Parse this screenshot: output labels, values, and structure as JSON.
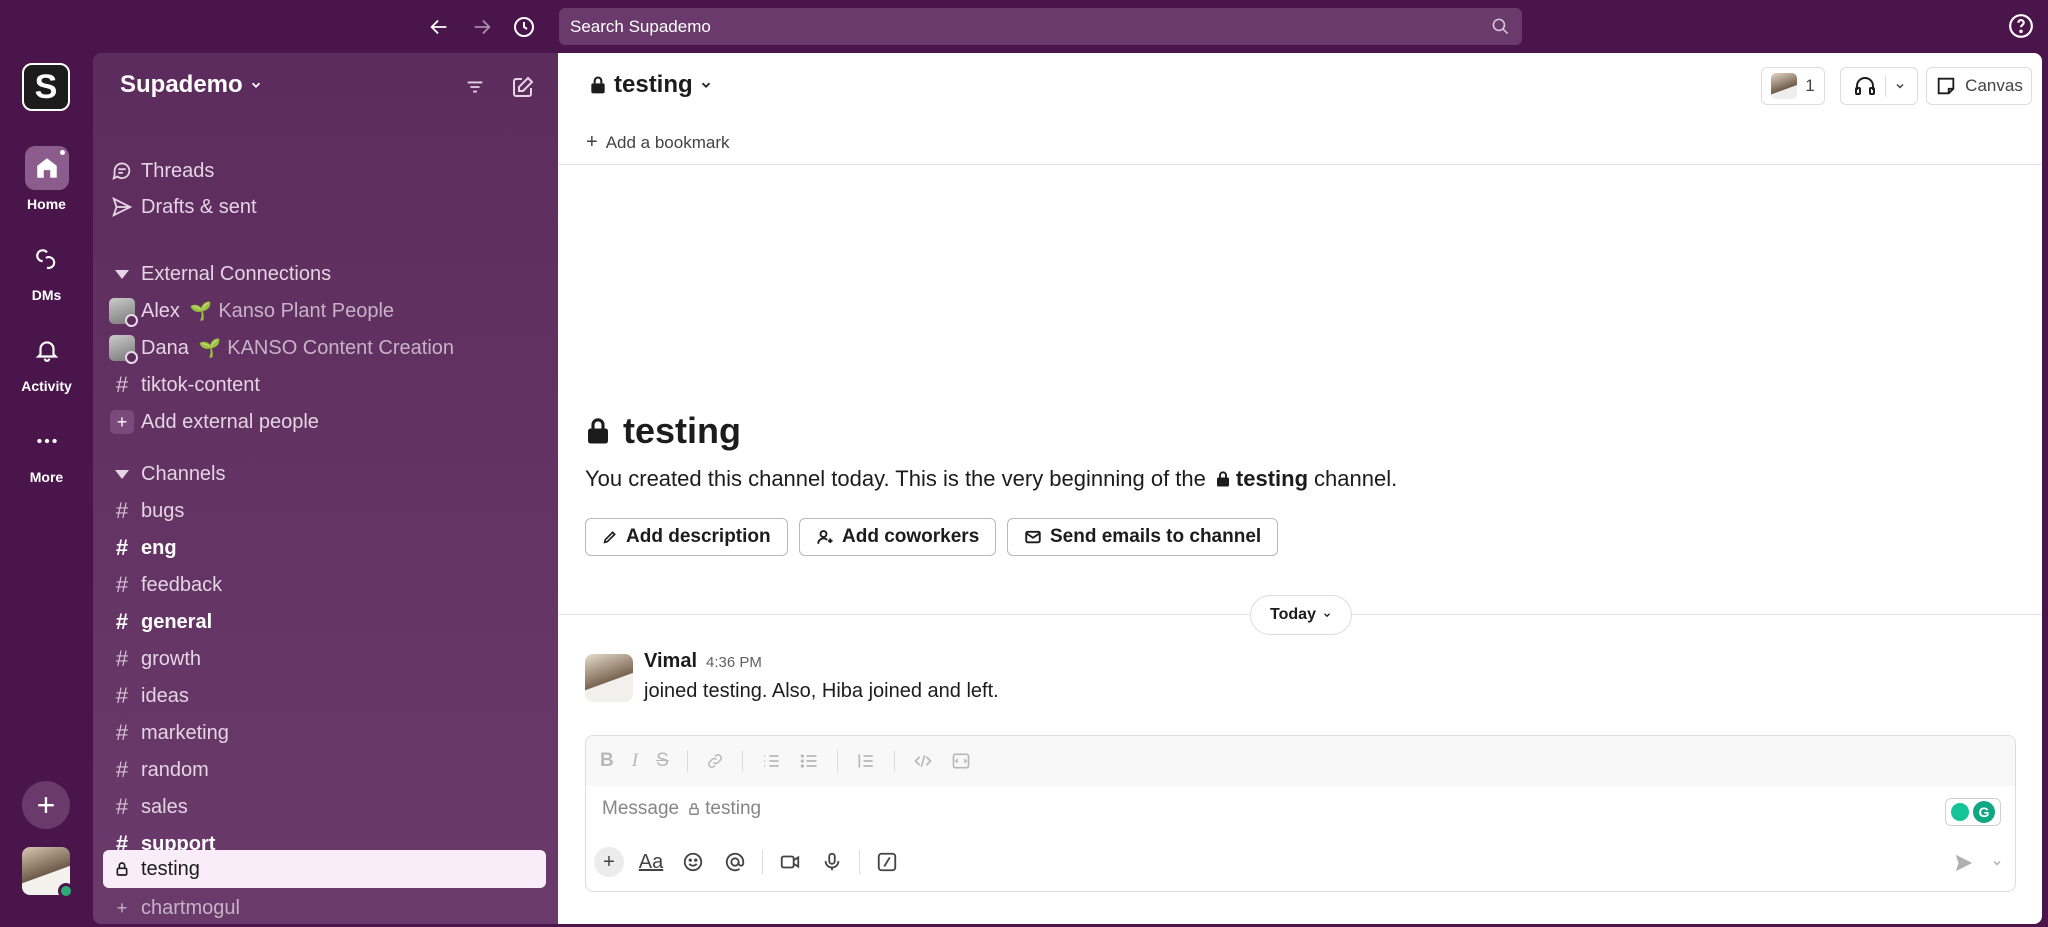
{
  "topbar": {
    "search_placeholder": "Search Supademo"
  },
  "rail": {
    "workspace_initial": "S",
    "items": [
      {
        "label": "Home",
        "icon": "home-icon"
      },
      {
        "label": "DMs",
        "icon": "dm-icon"
      },
      {
        "label": "Activity",
        "icon": "bell-icon"
      },
      {
        "label": "More",
        "icon": "more-icon"
      }
    ]
  },
  "sidebar": {
    "workspace_name": "Supademo",
    "threads": "Threads",
    "drafts": "Drafts & sent",
    "external_section": "External Connections",
    "external": [
      {
        "name": "Alex",
        "org": "Kanso Plant People"
      },
      {
        "name": "Dana",
        "org": "KANSO Content Creation"
      }
    ],
    "external_channel": "tiktok-content",
    "add_external": "Add external people",
    "channels_section": "Channels",
    "channels": [
      {
        "name": "bugs",
        "bold": false
      },
      {
        "name": "eng",
        "bold": true
      },
      {
        "name": "feedback",
        "bold": false
      },
      {
        "name": "general",
        "bold": true
      },
      {
        "name": "growth",
        "bold": false
      },
      {
        "name": "ideas",
        "bold": false
      },
      {
        "name": "marketing",
        "bold": false
      },
      {
        "name": "random",
        "bold": false
      },
      {
        "name": "sales",
        "bold": false
      },
      {
        "name": "support",
        "bold": true
      }
    ],
    "active_channel": "testing",
    "app_item": "chartmogul"
  },
  "channel": {
    "name": "testing",
    "add_bookmark": "Add a bookmark",
    "member_count": "1",
    "canvas_label": "Canvas",
    "intro_title": "testing",
    "intro_prefix": "You created this channel today. This is the very beginning of the",
    "intro_channel": "testing",
    "intro_suffix": "channel.",
    "buttons": {
      "add_description": "Add description",
      "add_coworkers": "Add coworkers",
      "send_emails": "Send emails to channel"
    },
    "today": "Today"
  },
  "message": {
    "author": "Vimal",
    "time": "4:36 PM",
    "text": "joined testing. Also, Hiba joined and left."
  },
  "composer": {
    "placeholder_prefix": "Message",
    "placeholder_channel": "testing"
  },
  "colors": {
    "aubergine": "#4a154b",
    "sidebar": "#5c2c5d",
    "active_row": "#f9edf9",
    "online": "#2bac76"
  }
}
